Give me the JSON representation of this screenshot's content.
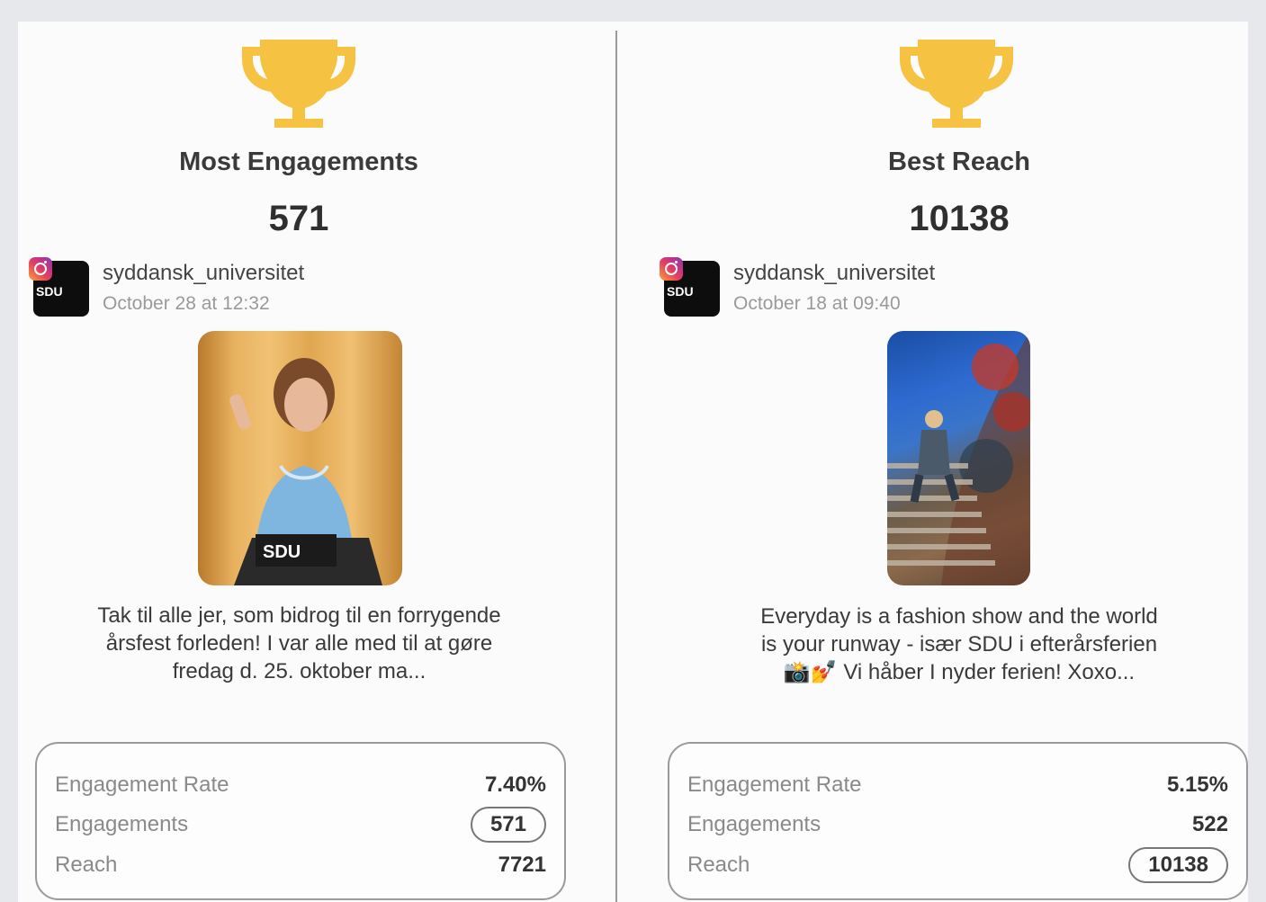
{
  "left": {
    "title": "Most Engagements",
    "big_value": "571",
    "account": "syddansk_universitet",
    "date": "October 28 at 12:32",
    "avatar_text": "SDU",
    "caption": "Tak til alle jer, som bidrog til en forrygende årsfest forleden! I var alle med til at gøre fredag d. 25. oktober ma...",
    "stats": {
      "engagement_rate_label": "Engagement Rate",
      "engagement_rate": "7.40%",
      "engagements_label": "Engagements",
      "engagements": "571",
      "reach_label": "Reach",
      "reach": "7721"
    }
  },
  "right": {
    "title": "Best Reach",
    "big_value": "10138",
    "account": "syddansk_universitet",
    "date": "October 18 at 09:40",
    "avatar_text": "SDU",
    "caption": "Everyday is a fashion show and the world is your runway - især SDU i efterårsferien📸💅 Vi håber I nyder ferien! Xoxo...",
    "stats": {
      "engagement_rate_label": "Engagement Rate",
      "engagement_rate": "5.15%",
      "engagements_label": "Engagements",
      "engagements": "522",
      "reach_label": "Reach",
      "reach": "10138"
    }
  },
  "colors": {
    "trophy": "#f5c242",
    "divider": "#9a9a9a"
  }
}
